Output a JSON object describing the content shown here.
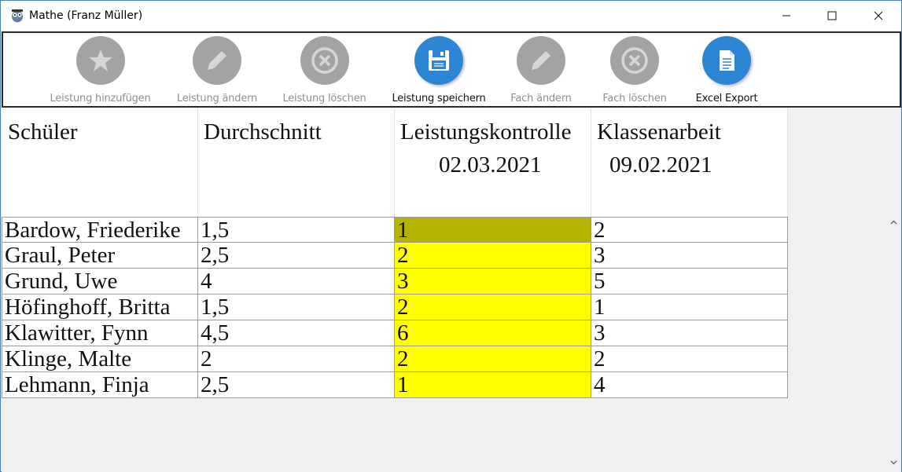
{
  "window": {
    "title": "Mathe (Franz Müller)",
    "accent_border": "#4a7fb8"
  },
  "toolbar": {
    "buttons": [
      {
        "label": "Leistung hinzufügen",
        "icon": "star-icon",
        "enabled": false
      },
      {
        "label": "Leistung ändern",
        "icon": "pencil-icon",
        "enabled": false
      },
      {
        "label": "Leistung löschen",
        "icon": "cancel-icon",
        "enabled": false
      },
      {
        "label": "Leistung speichern",
        "icon": "save-icon",
        "enabled": true
      },
      {
        "label": "Fach ändern",
        "icon": "pencil-icon",
        "enabled": false
      },
      {
        "label": "Fach löschen",
        "icon": "cancel-icon",
        "enabled": false
      },
      {
        "label": "Excel Export",
        "icon": "document-icon",
        "enabled": true
      }
    ],
    "enabled_color": "#2d86d3",
    "disabled_color": "#a3a3a3"
  },
  "table": {
    "headers": [
      {
        "line1": "Schüler",
        "line2": ""
      },
      {
        "line1": "Durchschnitt",
        "line2": ""
      },
      {
        "line1": "Leistungskontrolle",
        "line2": "02.03.2021"
      },
      {
        "line1": "Klassenarbeit",
        "line2": "09.02.2021"
      }
    ],
    "rows": [
      {
        "name": "Bardow, Friederike",
        "avg": "1,5",
        "lk": "1",
        "ka": "2",
        "selected": true
      },
      {
        "name": "Graul, Peter",
        "avg": "2,5",
        "lk": "2",
        "ka": "3",
        "selected": false
      },
      {
        "name": "Grund, Uwe",
        "avg": "4",
        "lk": "3",
        "ka": "5",
        "selected": false
      },
      {
        "name": "Höfinghoff, Britta",
        "avg": "1,5",
        "lk": "2",
        "ka": "1",
        "selected": false
      },
      {
        "name": "Klawitter, Fynn",
        "avg": "4,5",
        "lk": "6",
        "ka": "3",
        "selected": false
      },
      {
        "name": "Klinge, Malte",
        "avg": "2",
        "lk": "2",
        "ka": "2",
        "selected": false
      },
      {
        "name": "Lehmann, Finja",
        "avg": "2,5",
        "lk": "1",
        "ka": "4",
        "selected": false
      }
    ],
    "highlight_color": "#ffff00",
    "selected_highlight_color": "#b5b500"
  }
}
